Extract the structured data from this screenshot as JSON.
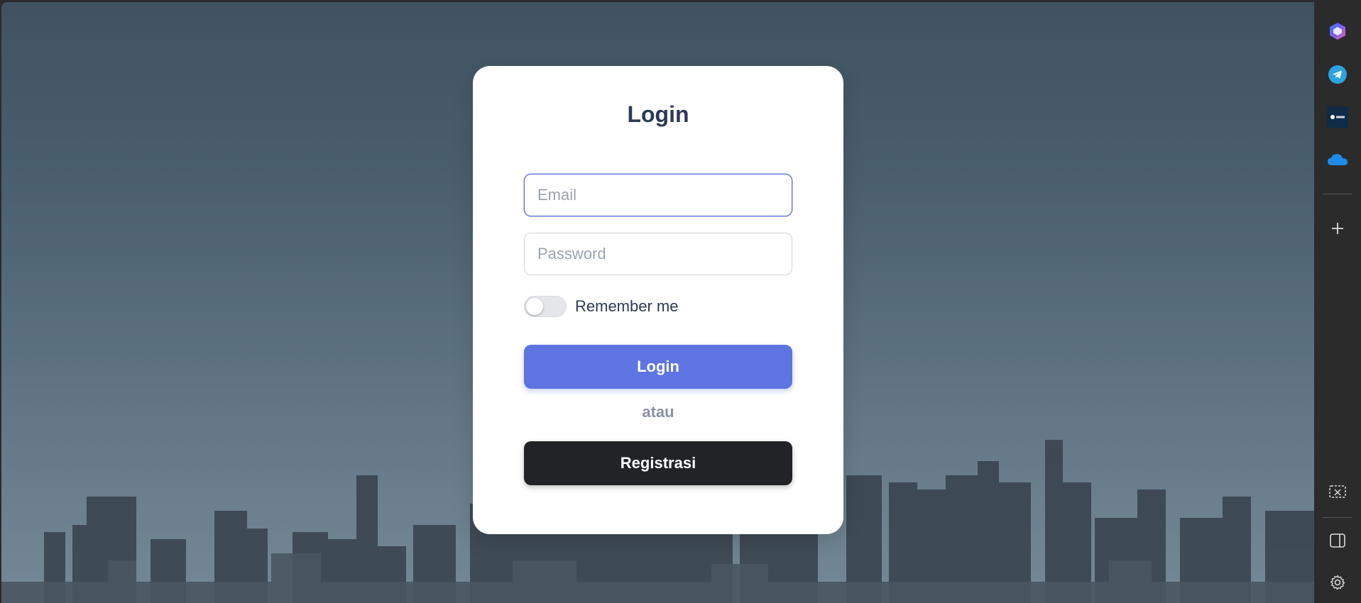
{
  "login_card": {
    "title": "Login",
    "email_placeholder": "Email",
    "password_placeholder": "Password",
    "remember_label": "Remember me",
    "remember_checked": false,
    "login_button": "Login",
    "or_text": "atau",
    "register_button": "Registrasi"
  },
  "colors": {
    "primary": "#5e74e1",
    "dark_button": "#222326",
    "title_text": "#2d3a56"
  },
  "sidebar": {
    "top_icons": [
      "copilot-icon",
      "telegram-icon",
      "deepl-icon",
      "onedrive-icon"
    ],
    "add_icon": "plus-icon",
    "bottom_icons": [
      "screenshot-icon",
      "sidebar-toggle-icon",
      "settings-icon"
    ]
  }
}
